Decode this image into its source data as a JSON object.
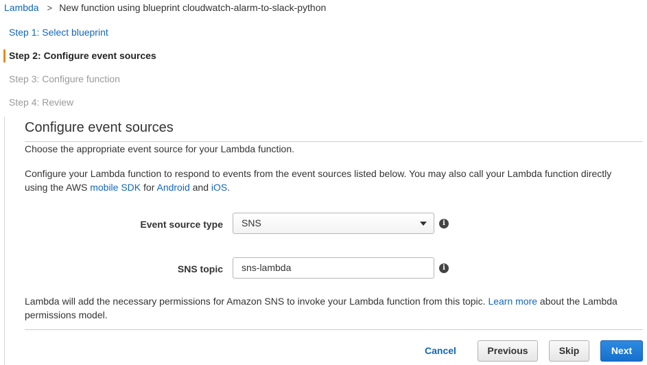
{
  "breadcrumb": {
    "root": "Lambda",
    "separator": ">",
    "current": "New function using blueprint cloudwatch-alarm-to-slack-python"
  },
  "steps": [
    {
      "label": "Step 1: Select blueprint",
      "state": "link"
    },
    {
      "label": "Step 2: Configure event sources",
      "state": "active"
    },
    {
      "label": "Step 3: Configure function",
      "state": "disabled"
    },
    {
      "label": "Step 4: Review",
      "state": "disabled"
    }
  ],
  "panel": {
    "title": "Configure event sources",
    "description": "Choose the appropriate event source for your Lambda function.",
    "paragraph": {
      "before": "Configure your Lambda function to respond to events from the event sources listed below. You may also call your Lambda function directly using the AWS ",
      "link_sdk": "mobile SDK",
      "for_text": " for ",
      "link_android": "Android",
      "and_text": " and ",
      "link_ios": "iOS",
      "end": "."
    },
    "event_source": {
      "label": "Event source type",
      "value": "SNS"
    },
    "sns_topic": {
      "label": "SNS topic",
      "value": "sns-lambda"
    },
    "info_glyph": "i",
    "permissions": {
      "before": "Lambda will add the necessary permissions for Amazon SNS to invoke your Lambda function from this topic. ",
      "link": "Learn more",
      "after": " about the Lambda permissions model."
    }
  },
  "buttons": {
    "cancel": "Cancel",
    "previous": "Previous",
    "skip": "Skip",
    "next": "Next"
  },
  "colors": {
    "link": "#1166bb",
    "active_step_bar": "#e7891a",
    "primary_button": "#1670cd"
  },
  "icons": {
    "breadcrumb_separator": "chevron-right-icon",
    "select_caret": "caret-down-icon",
    "info": "info-icon"
  }
}
